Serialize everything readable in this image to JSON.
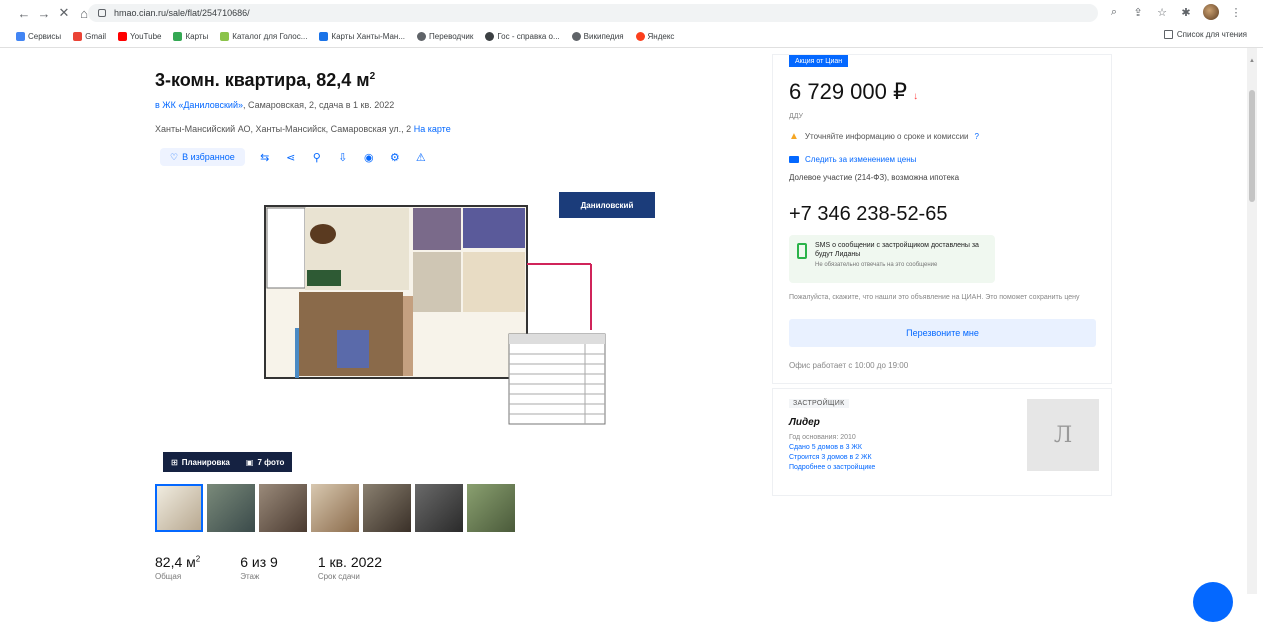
{
  "browser": {
    "url": "hmao.cian.ru/sale/flat/254710686/",
    "bookmarks": [
      "Сервисы",
      "Gmail",
      "YouTube",
      "Карты",
      "Каталог для Голос...",
      "Карты Ханты-Ман...",
      "Переводчик",
      "Гос - справка о...",
      "Википедия",
      "Яндекс"
    ],
    "reading_list": "Список для чтения"
  },
  "listing": {
    "title": "3-комн. квартира, 82,4 м",
    "title_sup": "2",
    "complex_link": "в ЖК «Даниловский»",
    "complex_rest": ", Самаровская, 2, сдача в 1 кв. 2022",
    "address": "Ханты-Мансийский АО, Ханты-Мансийск, Самаровская ул., 2",
    "address_link": "На карте",
    "favorite_label": "В избранное",
    "watermark": "Даниловский",
    "plan_label": "Планировка",
    "photo_label": "7 фото",
    "facts": [
      {
        "val": "82,4 м",
        "sup": "2",
        "lbl": "Общая"
      },
      {
        "val": "6 из 9",
        "sup": "",
        "lbl": "Этаж"
      },
      {
        "val": "1 кв. 2022",
        "sup": "",
        "lbl": "Срок сдачи"
      }
    ]
  },
  "offer": {
    "promo": "Акция от Циан",
    "price": "6 729 000 ₽",
    "price_note": "ДДУ",
    "warning": "Уточняйте информацию о сроке и комиссии",
    "warning_link": "?",
    "notify": "Следить за изменением цены",
    "participant": "Долевое участие (214-ФЗ), возможна ипотека",
    "phone": "+7 346 238-52-65",
    "sms_title": "SMS о сообщении с застройщиком доставлены за будут Лиданы",
    "sms_sub": "Не обязательно отвечать на это сообщение",
    "mention": "Пожалуйста, скажите, что нашли это объявление на ЦИАН. Это поможет сохранить цену",
    "callback": "Перезвоните мне",
    "hours": "Офис работает с 10:00 до 19:00"
  },
  "developer": {
    "tag": "ЗАСТРОЙЩИК",
    "name": "Лидер",
    "founded": "Год основания: 2010",
    "built": "Сдано 5 домов в 3 ЖК",
    "building": "Строится 3 домов в 2 ЖК",
    "more": "Подробнее о застройщике",
    "logo_letter": "Л"
  }
}
